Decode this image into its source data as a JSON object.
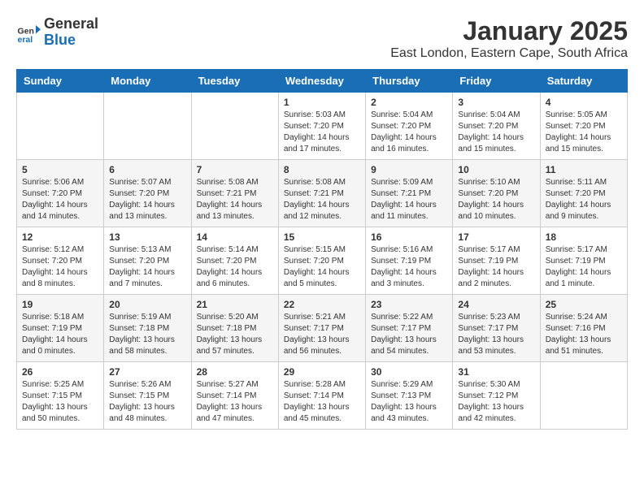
{
  "logo": {
    "general": "General",
    "blue": "Blue"
  },
  "title": "January 2025",
  "subtitle": "East London, Eastern Cape, South Africa",
  "days_of_week": [
    "Sunday",
    "Monday",
    "Tuesday",
    "Wednesday",
    "Thursday",
    "Friday",
    "Saturday"
  ],
  "weeks": [
    [
      {
        "day": "",
        "sunrise": "",
        "sunset": "",
        "daylight": ""
      },
      {
        "day": "",
        "sunrise": "",
        "sunset": "",
        "daylight": ""
      },
      {
        "day": "",
        "sunrise": "",
        "sunset": "",
        "daylight": ""
      },
      {
        "day": "1",
        "sunrise": "Sunrise: 5:03 AM",
        "sunset": "Sunset: 7:20 PM",
        "daylight": "Daylight: 14 hours and 17 minutes."
      },
      {
        "day": "2",
        "sunrise": "Sunrise: 5:04 AM",
        "sunset": "Sunset: 7:20 PM",
        "daylight": "Daylight: 14 hours and 16 minutes."
      },
      {
        "day": "3",
        "sunrise": "Sunrise: 5:04 AM",
        "sunset": "Sunset: 7:20 PM",
        "daylight": "Daylight: 14 hours and 15 minutes."
      },
      {
        "day": "4",
        "sunrise": "Sunrise: 5:05 AM",
        "sunset": "Sunset: 7:20 PM",
        "daylight": "Daylight: 14 hours and 15 minutes."
      }
    ],
    [
      {
        "day": "5",
        "sunrise": "Sunrise: 5:06 AM",
        "sunset": "Sunset: 7:20 PM",
        "daylight": "Daylight: 14 hours and 14 minutes."
      },
      {
        "day": "6",
        "sunrise": "Sunrise: 5:07 AM",
        "sunset": "Sunset: 7:20 PM",
        "daylight": "Daylight: 14 hours and 13 minutes."
      },
      {
        "day": "7",
        "sunrise": "Sunrise: 5:08 AM",
        "sunset": "Sunset: 7:21 PM",
        "daylight": "Daylight: 14 hours and 13 minutes."
      },
      {
        "day": "8",
        "sunrise": "Sunrise: 5:08 AM",
        "sunset": "Sunset: 7:21 PM",
        "daylight": "Daylight: 14 hours and 12 minutes."
      },
      {
        "day": "9",
        "sunrise": "Sunrise: 5:09 AM",
        "sunset": "Sunset: 7:21 PM",
        "daylight": "Daylight: 14 hours and 11 minutes."
      },
      {
        "day": "10",
        "sunrise": "Sunrise: 5:10 AM",
        "sunset": "Sunset: 7:20 PM",
        "daylight": "Daylight: 14 hours and 10 minutes."
      },
      {
        "day": "11",
        "sunrise": "Sunrise: 5:11 AM",
        "sunset": "Sunset: 7:20 PM",
        "daylight": "Daylight: 14 hours and 9 minutes."
      }
    ],
    [
      {
        "day": "12",
        "sunrise": "Sunrise: 5:12 AM",
        "sunset": "Sunset: 7:20 PM",
        "daylight": "Daylight: 14 hours and 8 minutes."
      },
      {
        "day": "13",
        "sunrise": "Sunrise: 5:13 AM",
        "sunset": "Sunset: 7:20 PM",
        "daylight": "Daylight: 14 hours and 7 minutes."
      },
      {
        "day": "14",
        "sunrise": "Sunrise: 5:14 AM",
        "sunset": "Sunset: 7:20 PM",
        "daylight": "Daylight: 14 hours and 6 minutes."
      },
      {
        "day": "15",
        "sunrise": "Sunrise: 5:15 AM",
        "sunset": "Sunset: 7:20 PM",
        "daylight": "Daylight: 14 hours and 5 minutes."
      },
      {
        "day": "16",
        "sunrise": "Sunrise: 5:16 AM",
        "sunset": "Sunset: 7:19 PM",
        "daylight": "Daylight: 14 hours and 3 minutes."
      },
      {
        "day": "17",
        "sunrise": "Sunrise: 5:17 AM",
        "sunset": "Sunset: 7:19 PM",
        "daylight": "Daylight: 14 hours and 2 minutes."
      },
      {
        "day": "18",
        "sunrise": "Sunrise: 5:17 AM",
        "sunset": "Sunset: 7:19 PM",
        "daylight": "Daylight: 14 hours and 1 minute."
      }
    ],
    [
      {
        "day": "19",
        "sunrise": "Sunrise: 5:18 AM",
        "sunset": "Sunset: 7:19 PM",
        "daylight": "Daylight: 14 hours and 0 minutes."
      },
      {
        "day": "20",
        "sunrise": "Sunrise: 5:19 AM",
        "sunset": "Sunset: 7:18 PM",
        "daylight": "Daylight: 13 hours and 58 minutes."
      },
      {
        "day": "21",
        "sunrise": "Sunrise: 5:20 AM",
        "sunset": "Sunset: 7:18 PM",
        "daylight": "Daylight: 13 hours and 57 minutes."
      },
      {
        "day": "22",
        "sunrise": "Sunrise: 5:21 AM",
        "sunset": "Sunset: 7:17 PM",
        "daylight": "Daylight: 13 hours and 56 minutes."
      },
      {
        "day": "23",
        "sunrise": "Sunrise: 5:22 AM",
        "sunset": "Sunset: 7:17 PM",
        "daylight": "Daylight: 13 hours and 54 minutes."
      },
      {
        "day": "24",
        "sunrise": "Sunrise: 5:23 AM",
        "sunset": "Sunset: 7:17 PM",
        "daylight": "Daylight: 13 hours and 53 minutes."
      },
      {
        "day": "25",
        "sunrise": "Sunrise: 5:24 AM",
        "sunset": "Sunset: 7:16 PM",
        "daylight": "Daylight: 13 hours and 51 minutes."
      }
    ],
    [
      {
        "day": "26",
        "sunrise": "Sunrise: 5:25 AM",
        "sunset": "Sunset: 7:15 PM",
        "daylight": "Daylight: 13 hours and 50 minutes."
      },
      {
        "day": "27",
        "sunrise": "Sunrise: 5:26 AM",
        "sunset": "Sunset: 7:15 PM",
        "daylight": "Daylight: 13 hours and 48 minutes."
      },
      {
        "day": "28",
        "sunrise": "Sunrise: 5:27 AM",
        "sunset": "Sunset: 7:14 PM",
        "daylight": "Daylight: 13 hours and 47 minutes."
      },
      {
        "day": "29",
        "sunrise": "Sunrise: 5:28 AM",
        "sunset": "Sunset: 7:14 PM",
        "daylight": "Daylight: 13 hours and 45 minutes."
      },
      {
        "day": "30",
        "sunrise": "Sunrise: 5:29 AM",
        "sunset": "Sunset: 7:13 PM",
        "daylight": "Daylight: 13 hours and 43 minutes."
      },
      {
        "day": "31",
        "sunrise": "Sunrise: 5:30 AM",
        "sunset": "Sunset: 7:12 PM",
        "daylight": "Daylight: 13 hours and 42 minutes."
      },
      {
        "day": "",
        "sunrise": "",
        "sunset": "",
        "daylight": ""
      }
    ]
  ]
}
